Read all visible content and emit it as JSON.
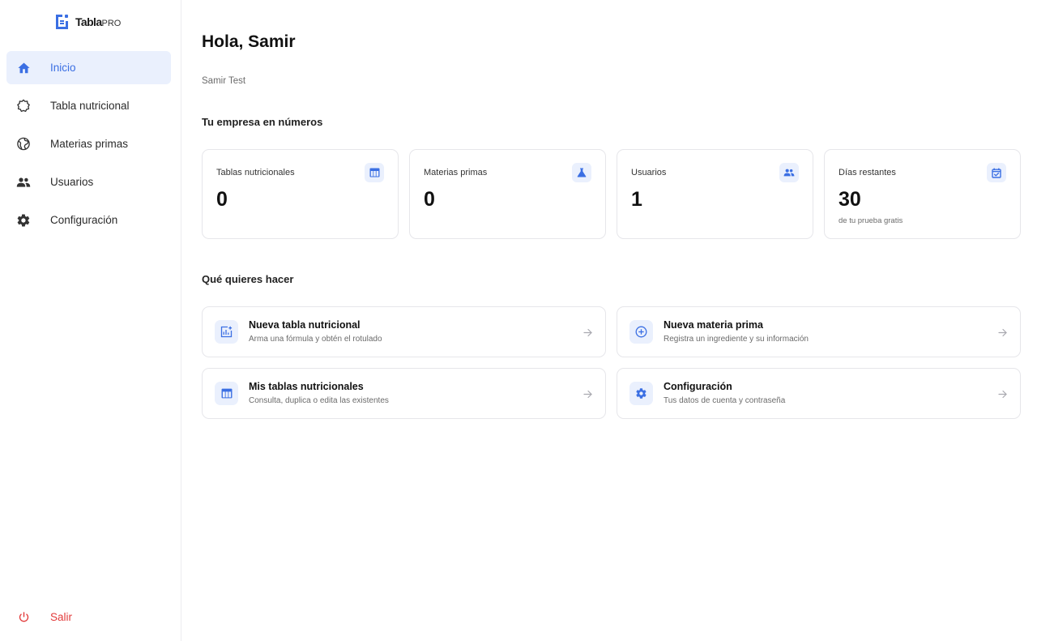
{
  "brand": {
    "name": "Tabla",
    "suffix": "PRO",
    "accent_color": "#3b6fe3"
  },
  "sidebar": {
    "items": [
      {
        "label": "Inicio",
        "icon": "home-icon",
        "active": true
      },
      {
        "label": "Tabla nutricional",
        "icon": "badge-icon",
        "active": false
      },
      {
        "label": "Materias primas",
        "icon": "globe-icon",
        "active": false
      },
      {
        "label": "Usuarios",
        "icon": "users-icon",
        "active": false
      },
      {
        "label": "Configuración",
        "icon": "gear-icon",
        "active": false
      }
    ],
    "logout": {
      "label": "Salir",
      "icon": "power-icon",
      "color": "#e23b3b"
    }
  },
  "main": {
    "greeting": "Hola, Samir",
    "user_name": "Samir Test",
    "stats_title": "Tu empresa en números",
    "stats": [
      {
        "label": "Tablas nutricionales",
        "value": "0",
        "icon": "table-icon"
      },
      {
        "label": "Materias primas",
        "value": "0",
        "icon": "flask-icon"
      },
      {
        "label": "Usuarios",
        "value": "1",
        "icon": "users-icon"
      },
      {
        "label": "Días restantes",
        "value": "30",
        "note": "de tu prueba gratis",
        "icon": "calendar-check-icon"
      }
    ],
    "actions_title": "Qué quieres hacer",
    "actions": [
      {
        "title": "Nueva tabla nutricional",
        "desc": "Arma una fórmula y obtén el rotulado",
        "icon": "chart-add-icon"
      },
      {
        "title": "Nueva materia prima",
        "desc": "Registra un ingrediente y su información",
        "icon": "plus-circle-icon"
      },
      {
        "title": "Mis tablas nutricionales",
        "desc": "Consulta, duplica o edita las existentes",
        "icon": "table-icon"
      },
      {
        "title": "Configuración",
        "desc": "Tus datos de cuenta y contraseña",
        "icon": "gear-icon"
      }
    ]
  }
}
